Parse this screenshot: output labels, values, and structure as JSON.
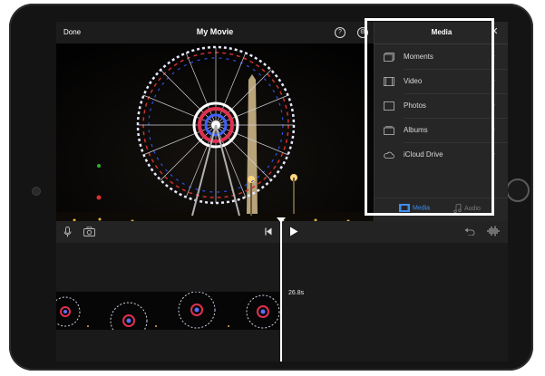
{
  "header": {
    "done_label": "Done",
    "title": "My Movie",
    "help_icon": "?",
    "settings_icon": "⚙"
  },
  "media_panel": {
    "title": "Media",
    "close_icon": "✕",
    "items": [
      {
        "label": "Moments",
        "icon": "moments-icon"
      },
      {
        "label": "Video",
        "icon": "video-icon"
      },
      {
        "label": "Photos",
        "icon": "photos-icon"
      },
      {
        "label": "Albums",
        "icon": "albums-icon"
      },
      {
        "label": "iCloud Drive",
        "icon": "icloud-icon"
      }
    ],
    "chevron": "›",
    "tabs": [
      {
        "label": "Media",
        "active": true
      },
      {
        "label": "Audio",
        "active": false
      }
    ]
  },
  "timeline": {
    "duration": "26.8s"
  },
  "colors": {
    "accent": "#3d8ef0",
    "panel_bg": "#262626",
    "screen_bg": "#1c1c1c"
  }
}
